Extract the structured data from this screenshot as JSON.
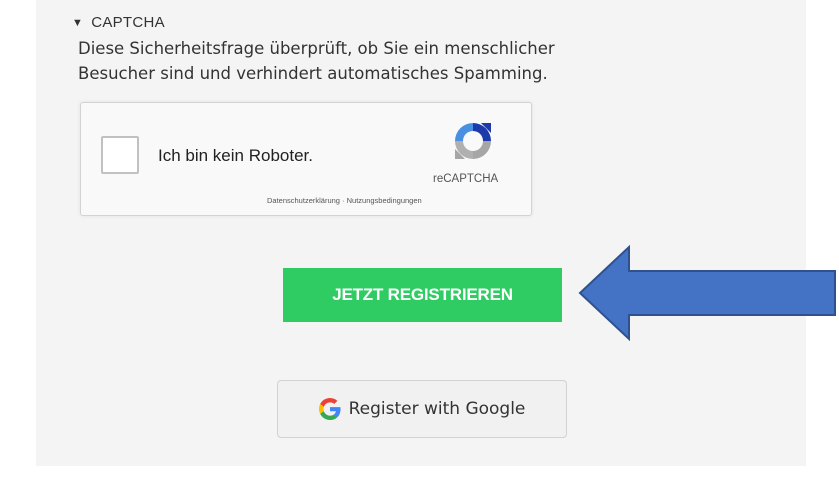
{
  "captcha": {
    "heading": "CAPTCHA",
    "description_line1": "Diese Sicherheitsfrage überprüft, ob Sie ein menschlicher",
    "description_line2": "Besucher sind und verhindert automatisches Spamming."
  },
  "recaptcha": {
    "checkbox_label": "Ich bin kein Roboter.",
    "brand": "reCAPTCHA",
    "links": "Datenschutzerklärung · Nutzungsbedingungen",
    "checked": false
  },
  "actions": {
    "register_label": "JETZT REGISTRIEREN",
    "google_label": "Register with Google"
  },
  "colors": {
    "register_button": "#2ecc62",
    "arrow": "#4472c4",
    "panel_background": "#f4f4f4"
  },
  "icons": {
    "collapse": "triangle-down-icon",
    "recaptcha": "recaptcha-logo-icon",
    "google": "google-g-icon",
    "annotation": "arrow-left-icon"
  }
}
